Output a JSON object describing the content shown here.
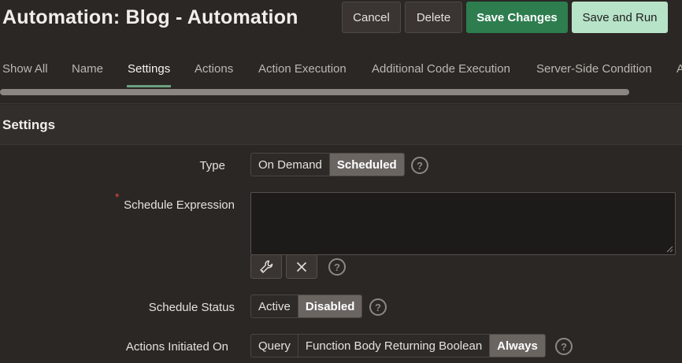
{
  "header": {
    "title": "Automation: Blog - Automation",
    "buttons": {
      "cancel": "Cancel",
      "delete": "Delete",
      "save_changes": "Save Changes",
      "save_and_run": "Save and Run"
    }
  },
  "tabs": [
    {
      "label": "Show All"
    },
    {
      "label": "Name"
    },
    {
      "label": "Settings",
      "active": true
    },
    {
      "label": "Actions"
    },
    {
      "label": "Action Execution"
    },
    {
      "label": "Additional Code Execution"
    },
    {
      "label": "Server-Side Condition"
    },
    {
      "label": "A"
    }
  ],
  "region": {
    "title": "Settings"
  },
  "fields": {
    "type": {
      "label": "Type",
      "options": [
        "On Demand",
        "Scheduled"
      ],
      "selected": "Scheduled"
    },
    "schedule_expression": {
      "label": "Schedule Expression",
      "required_marker": "*",
      "value": "",
      "buttons": [
        "wrench-icon",
        "close-icon"
      ]
    },
    "schedule_status": {
      "label": "Schedule Status",
      "options": [
        "Active",
        "Disabled"
      ],
      "selected": "Disabled"
    },
    "actions_initiated_on": {
      "label": "Actions Initiated On",
      "options": [
        "Query",
        "Function Body Returning Boolean",
        "Always"
      ],
      "selected": "Always"
    }
  },
  "help_glyph": "?",
  "colors": {
    "background": "#2b2725",
    "accent_hot": "#2e7d4f",
    "accent_light": "#b7e3c8",
    "tab_underline": "#6aa07e",
    "required": "#e04848"
  }
}
